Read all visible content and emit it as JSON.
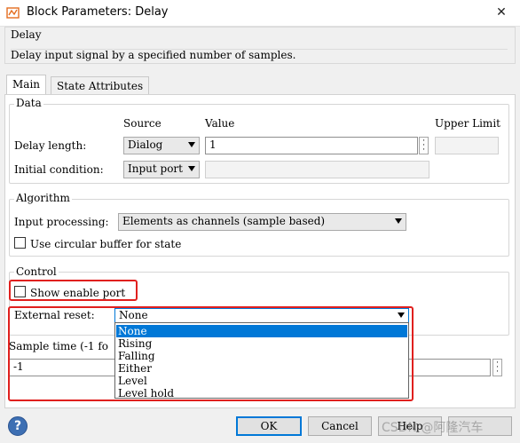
{
  "window": {
    "title": "Block Parameters: Delay",
    "close_glyph": "✕"
  },
  "header": {
    "block_name": "Delay",
    "description": "Delay input signal by a specified number of samples."
  },
  "tabs": [
    {
      "label": "Main",
      "active": true
    },
    {
      "label": "State Attributes",
      "active": false
    }
  ],
  "data_group": {
    "legend": "Data",
    "col_source": "Source",
    "col_value": "Value",
    "col_upper": "Upper Limit",
    "delay_length_label": "Delay length:",
    "delay_length_source": "Dialog",
    "delay_length_value": "1",
    "initial_condition_label": "Initial condition:",
    "initial_condition_source": "Input port",
    "initial_condition_value": "",
    "upper_limit_value": ""
  },
  "algorithm_group": {
    "legend": "Algorithm",
    "input_processing_label": "Input processing:",
    "input_processing_value": "Elements as channels (sample based)",
    "circular_buffer_label": "Use circular buffer for state",
    "circular_buffer_checked": false
  },
  "control_group": {
    "legend": "Control",
    "show_enable_port_label": "Show enable port",
    "show_enable_port_checked": false,
    "external_reset_label": "External reset:",
    "external_reset_value": "None",
    "external_reset_options": [
      "None",
      "Rising",
      "Falling",
      "Either",
      "Level",
      "Level hold"
    ],
    "external_reset_selected_index": 0
  },
  "sample_time": {
    "label": "Sample time (-1 fo",
    "value": "-1"
  },
  "buttons": {
    "ok": "OK",
    "cancel": "Cancel",
    "help": "Help"
  },
  "icons": {
    "help": "help-icon",
    "app": "simulink-block-icon",
    "close": "close-icon",
    "edit_ellipsis": "ellipsis-icon"
  },
  "colors": {
    "highlight": "#e0201e",
    "selection": "#0078d7",
    "help_icon": "#3d6fb3"
  },
  "watermark": "CSDN @阿隆汽车"
}
